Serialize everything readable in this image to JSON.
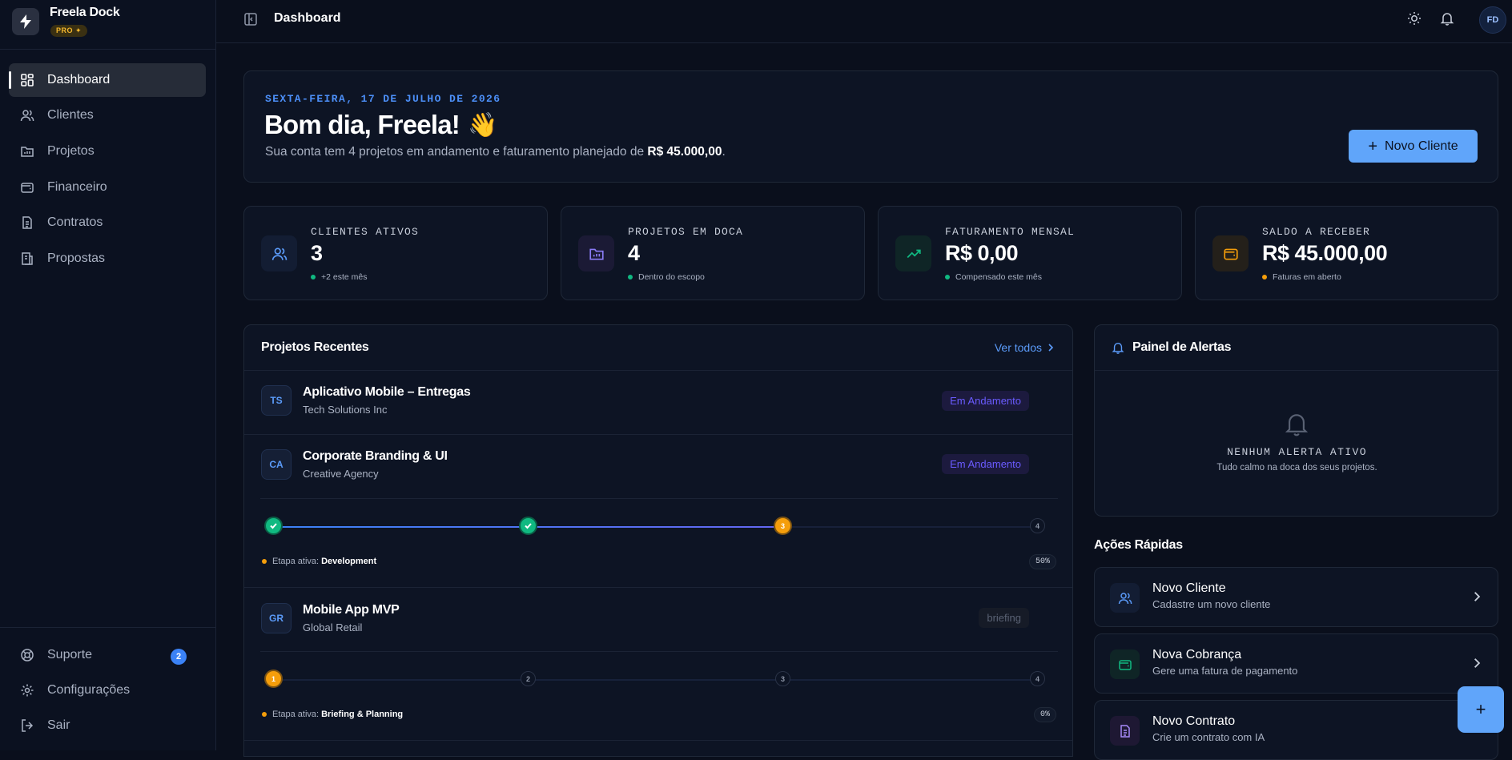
{
  "brand": {
    "name": "Freela Dock",
    "badge": "PRO ✦"
  },
  "sidebar": {
    "items": [
      {
        "label": "Dashboard"
      },
      {
        "label": "Clientes"
      },
      {
        "label": "Projetos"
      },
      {
        "label": "Financeiro"
      },
      {
        "label": "Contratos"
      },
      {
        "label": "Propostas"
      }
    ],
    "bottom": [
      {
        "label": "Suporte",
        "badge": "2"
      },
      {
        "label": "Configurações"
      },
      {
        "label": "Sair"
      }
    ]
  },
  "topbar": {
    "title": "Dashboard",
    "avatar": "FD"
  },
  "welcome": {
    "date": "SEXTA-FEIRA, 17 DE JULHO DE 2026",
    "greeting": "Bom dia, Freela!",
    "emoji": "👋",
    "sub_prefix": "Sua conta tem 4 projetos em andamento e faturamento planejado de ",
    "sub_amount": "R$ 45.000,00",
    "sub_suffix": ".",
    "button": "Novo Cliente"
  },
  "stats": [
    {
      "label": "CLIENTES ATIVOS",
      "value": "3",
      "note": "+2 este mês",
      "color": "#10b981"
    },
    {
      "label": "PROJETOS EM DOCA",
      "value": "4",
      "note": "Dentro do escopo",
      "color": "#10b981"
    },
    {
      "label": "FATURAMENTO MENSAL",
      "value": "R$ 0,00",
      "note": "Compensado este mês",
      "color": "#10b981"
    },
    {
      "label": "SALDO A RECEBER",
      "value": "R$ 45.000,00",
      "note": "Faturas em aberto",
      "color": "#f59e0b"
    }
  ],
  "projects": {
    "title": "Projetos Recentes",
    "see_all": "Ver todos",
    "stage_prefix": "Etapa ativa:",
    "items": [
      {
        "initials": "TS",
        "name": "Aplicativo Mobile – Entregas",
        "client": "Tech Solutions Inc",
        "status": "Em Andamento"
      },
      {
        "initials": "CA",
        "name": "Corporate Branding & UI",
        "client": "Creative Agency",
        "status": "Em Andamento",
        "steps": [
          "",
          "",
          "3",
          "4"
        ],
        "stage": "Development",
        "percent": "50%"
      },
      {
        "initials": "GR",
        "name": "Mobile App MVP",
        "client": "Global Retail",
        "status": "briefing",
        "steps": [
          "1",
          "2",
          "3",
          "4"
        ],
        "stage": "Briefing & Planning",
        "percent": "0%"
      }
    ]
  },
  "alerts": {
    "title": "Painel de Alertas",
    "empty_title": "NENHUM ALERTA ATIVO",
    "empty_sub": "Tudo calmo na doca dos seus projetos."
  },
  "quick_actions": {
    "title": "Ações Rápidas",
    "items": [
      {
        "title": "Novo Cliente",
        "sub": "Cadastre um novo cliente"
      },
      {
        "title": "Nova Cobrança",
        "sub": "Gere uma fatura de pagamento"
      },
      {
        "title": "Novo Contrato",
        "sub": "Crie um contrato com IA"
      }
    ]
  },
  "fab": "+"
}
